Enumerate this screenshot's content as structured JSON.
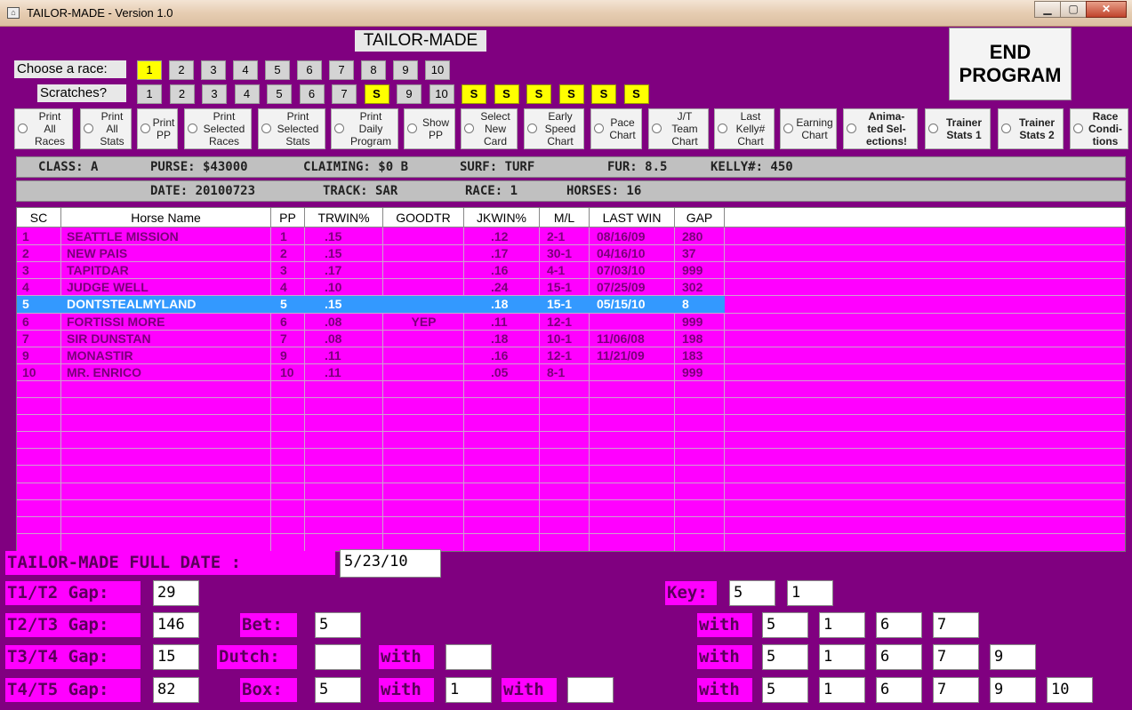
{
  "window": {
    "title": "TAILOR-MADE - Version 1.0",
    "icon": "app-icon"
  },
  "header": {
    "app_title": "TAILOR-MADE",
    "end_button": "END PROGRAM"
  },
  "choose_race": {
    "label": "Choose  a race:",
    "buttons": [
      "1",
      "2",
      "3",
      "4",
      "5",
      "6",
      "7",
      "8",
      "9",
      "10"
    ],
    "selected": "1"
  },
  "scratches": {
    "label": "Scratches?",
    "buttons": [
      "1",
      "2",
      "3",
      "4",
      "5",
      "6",
      "7",
      "S",
      "9",
      "10",
      "S",
      "S",
      "S",
      "S",
      "S",
      "S"
    ]
  },
  "options": [
    "Print\nAll\nRaces",
    "Print\nAll\nStats",
    "Print\nPP",
    "Print\nSelected\nRaces",
    "Print\nSelected\nStats",
    "Print\nDaily\nProgram",
    "Show\nPP",
    "Select\nNew\nCard",
    "Early\nSpeed\nChart",
    "Pace\nChart",
    "J/T\nTeam\nChart",
    "Last\nKelly#\nChart",
    "Earning\nChart",
    "Anima-\nted Sel-\nections!",
    "Trainer\nStats 1",
    "Trainer\nStats 2",
    "Race\nCondi-\ntions"
  ],
  "race_info": {
    "class": "CLASS: A",
    "purse": "PURSE: $43000",
    "claiming": "CLAIMING: $0 B",
    "surf": "SURF: TURF",
    "fur": "FUR: 8.5",
    "kelly": "KELLY#: 450",
    "date": "DATE: 20100723",
    "track": "TRACK: SAR",
    "race": "RACE: 1",
    "horses": "HORSES: 16"
  },
  "table": {
    "columns": [
      "SC",
      "Horse Name",
      "PP",
      "TRWIN%",
      "GOODTR",
      "JKWIN%",
      "M/L",
      "LAST WIN",
      "GAP"
    ],
    "selected_row": 4,
    "rows": [
      [
        "1",
        "SEATTLE MISSION",
        "1",
        ".15",
        "",
        ".12",
        "2-1",
        "08/16/09",
        "280"
      ],
      [
        "2",
        "NEW PAIS",
        "2",
        ".15",
        "",
        ".17",
        "30-1",
        "04/16/10",
        "37"
      ],
      [
        "3",
        "TAPITDAR",
        "3",
        ".17",
        "",
        ".16",
        "4-1",
        "07/03/10",
        "999"
      ],
      [
        "4",
        "JUDGE WELL",
        "4",
        ".10",
        "",
        ".24",
        "15-1",
        "07/25/09",
        "302"
      ],
      [
        "5",
        "DONTSTEALMYLAND",
        "5",
        ".15",
        "",
        ".18",
        "15-1",
        "05/15/10",
        "8"
      ],
      [
        "6",
        "FORTISSI MORE",
        "6",
        ".08",
        "YEP",
        ".11",
        "12-1",
        "",
        "999"
      ],
      [
        "7",
        "SIR DUNSTAN",
        "7",
        ".08",
        "",
        ".18",
        "10-1",
        "11/06/08",
        "198"
      ],
      [
        "9",
        "MONASTIR",
        "9",
        ".11",
        "",
        ".16",
        "12-1",
        "11/21/09",
        "183"
      ],
      [
        "10",
        "MR. ENRICO",
        "10",
        ".11",
        "",
        ".05",
        "8-1",
        "",
        "999"
      ]
    ]
  },
  "bottom": {
    "full_date_label": "TAILOR-MADE FULL DATE :",
    "full_date_value": "5/23/10",
    "t1t2_label": "T1/T2 Gap:",
    "t1t2_value": "29",
    "t2t3_label": "T2/T3 Gap:",
    "t2t3_value": "146",
    "t3t4_label": "T3/T4 Gap:",
    "t3t4_value": "15",
    "t4t5_label": "T4/T5 Gap:",
    "t4t5_value": "82",
    "bet_label": "Bet:",
    "bet_value": "5",
    "dutch_label": "Dutch:",
    "dutch_value": "",
    "dutch_with_label": "with",
    "dutch_with_value": "",
    "box_label": "Box:",
    "box_value": "5",
    "box_with1_label": "with",
    "box_with1_value": "1",
    "box_with2_label": "with",
    "box_with2_value": "",
    "key_label": "Key:",
    "key_values": [
      "5",
      "1"
    ],
    "with_label": "with",
    "with_row1": [
      "5",
      "1",
      "6",
      "7"
    ],
    "with_row2": [
      "5",
      "1",
      "6",
      "7",
      "9"
    ],
    "with_row3": [
      "5",
      "1",
      "6",
      "7",
      "9",
      "10"
    ]
  }
}
